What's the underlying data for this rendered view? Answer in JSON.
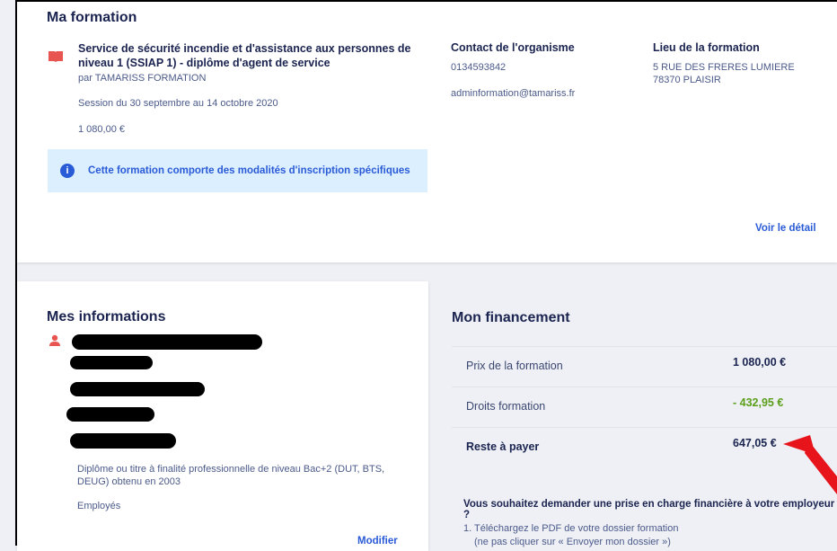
{
  "formation": {
    "heading": "Ma formation",
    "course_title": "Service de sécurité incendie et d'assistance aux personnes de niveau 1 (SSIAP 1) - diplôme d'agent de service",
    "provider": "par TAMARISS FORMATION",
    "session": "Session du 30 septembre au 14 octobre 2020",
    "price": "1 080,00 €",
    "notice": "Cette formation comporte des modalités d'inscription spécifiques",
    "detail_link": "Voir le détail",
    "contact": {
      "heading": "Contact de l'organisme",
      "phone": "0134593842",
      "email": "adminformation@tamariss.fr"
    },
    "location": {
      "heading": "Lieu de la formation",
      "line1": "5 RUE DES FRERES LUMIERE",
      "line2": "78370 PLAISIR"
    }
  },
  "informations": {
    "heading": "Mes informations",
    "diploma": "Diplôme ou titre à finalité professionnelle de niveau Bac+2 (DUT, BTS, DEUG) obtenu en 2003",
    "status": "Employés",
    "edit_link": "Modifier"
  },
  "financement": {
    "heading": "Mon financement",
    "rows": [
      {
        "label": "Prix de la formation",
        "value": "1 080,00 €"
      },
      {
        "label": "Droits formation",
        "value": "- 432,95 €"
      },
      {
        "label": "Reste à payer",
        "value": "647,05 €"
      }
    ],
    "employer_question": "Vous souhaitez demander une prise en charge financière à votre employeur ?",
    "steps": [
      "1. Téléchargez le PDF de votre dossier formation",
      "(ne pas cliquer sur « Envoyer mon dossier »)"
    ]
  },
  "colors": {
    "accent": "#2a5bd7",
    "icon_red": "#e8544f",
    "credit_green": "#5a9e1a",
    "annotation_arrow": "#e8141c"
  },
  "icons": [
    "book-icon",
    "info-icon",
    "person-icon"
  ]
}
